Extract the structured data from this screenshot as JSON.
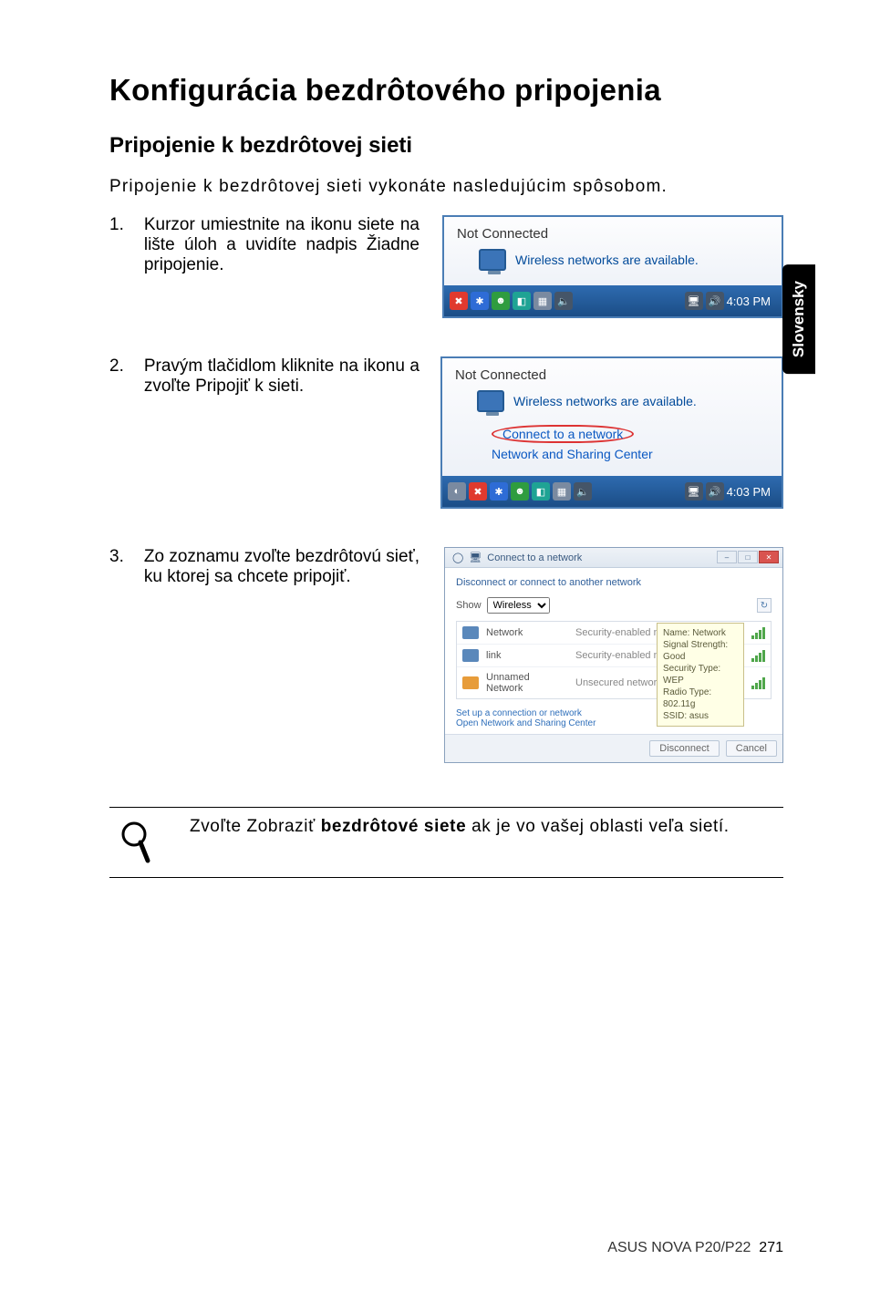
{
  "side_tab": "Slovensky",
  "heading": "Konfigurácia bezdrôtového pripojenia",
  "subheading": "Pripojenie k bezdrôtovej sieti",
  "intro": "Pripojenie k bezdrôtovej sieti vykonáte nasledujúcim spôsobom.",
  "steps": {
    "s1_num": "1.",
    "s1_body": "Kurzor umiestnite na ikonu siete na lište úloh a uvidíte nadpis Žiadne pripojenie.",
    "s2_num": "2.",
    "s2_body": "Pravým tlačidlom kliknite na ikonu a zvoľte Pripojiť k sieti.",
    "s3_num": "3.",
    "s3_body": "Zo zoznamu zvoľte bezdrôtovú sieť, ku ktorej sa chcete pripojiť."
  },
  "shot": {
    "not_connected": "Not Connected",
    "avail_msg": "Wireless networks are available.",
    "connect_link": "Connect to a network",
    "nsc_link": "Network and Sharing Center",
    "time": "4:03 PM"
  },
  "dialog": {
    "title": "Connect to a network",
    "subtitle": "Disconnect or connect to another network",
    "show_label": "Show",
    "show_value": "Wireless",
    "net1_name": "Network",
    "net1_type": "Security-enabled network",
    "net2_name": "link",
    "net2_type": "Security-enabled network",
    "net3_name": "Unnamed Network",
    "net3_type": "Unsecured network",
    "tooltip": "Name: Network\nSignal Strength: Good\nSecurity Type: WEP\nRadio Type: 802.11g\nSSID: asus",
    "link1": "Set up a connection or network",
    "link2": "Open Network and Sharing Center",
    "btn_disconnect": "Disconnect",
    "btn_cancel": "Cancel"
  },
  "note": {
    "prefix": "Zvoľte Zobraziť ",
    "bold": "bezdrôtové siete",
    "suffix": " ak je vo vašej oblasti veľa sietí."
  },
  "footer": {
    "product": "ASUS NOVA P20/P22",
    "page": "271"
  }
}
